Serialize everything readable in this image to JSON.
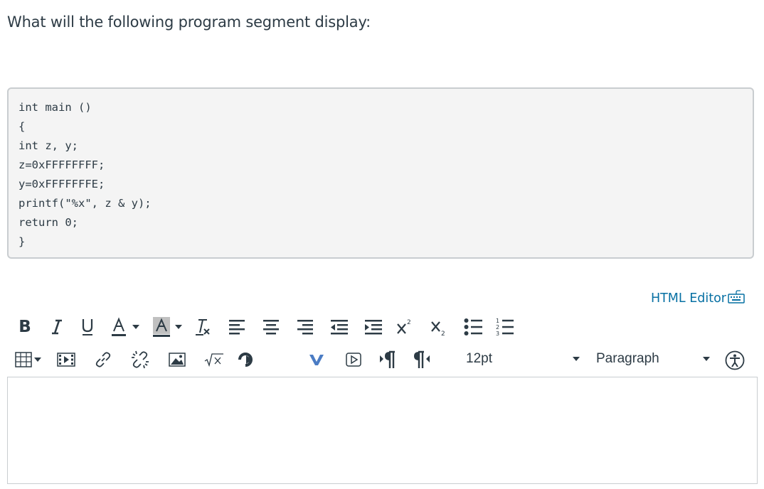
{
  "question": {
    "text": "What will the following program segment display:"
  },
  "code": {
    "lines": [
      "int main ()",
      "{",
      "int z, y;",
      "z=0xFFFFFFFF;",
      "y=0xFFFFFFFE;",
      "printf(\"%x\", z & y);",
      "return 0;",
      "}"
    ]
  },
  "editor": {
    "html_editor_label": "HTML Editor",
    "font_size_value": "12pt",
    "block_format_value": "Paragraph",
    "body_text": ""
  },
  "colors": {
    "text": "#2d3b45",
    "link": "#0770a3",
    "code_background": "#f4f4f4",
    "border": "#c9cdd0",
    "text_color_indicator": "#2d3b45",
    "highlight_indicator": "#c0c0c0",
    "vimeo_brand": "#4b7cc4"
  },
  "toolbar": {
    "row1_icons": [
      "bold-icon",
      "italic-icon",
      "underline-icon",
      "text-color-icon",
      "background-color-icon",
      "clear-formatting-icon",
      "align-left-icon",
      "align-center-icon",
      "align-right-icon",
      "outdent-icon",
      "indent-icon",
      "superscript-icon",
      "subscript-icon",
      "bullet-list-icon",
      "numbered-list-icon"
    ],
    "row2_icons": [
      "table-icon",
      "media-icon",
      "link-icon",
      "unlink-icon",
      "image-icon",
      "math-equation-icon",
      "lti-tool-icon",
      "vimeo-icon",
      "media-record-icon",
      "ltr-paragraph-icon",
      "rtl-paragraph-icon",
      "accessibility-checker-icon"
    ]
  }
}
